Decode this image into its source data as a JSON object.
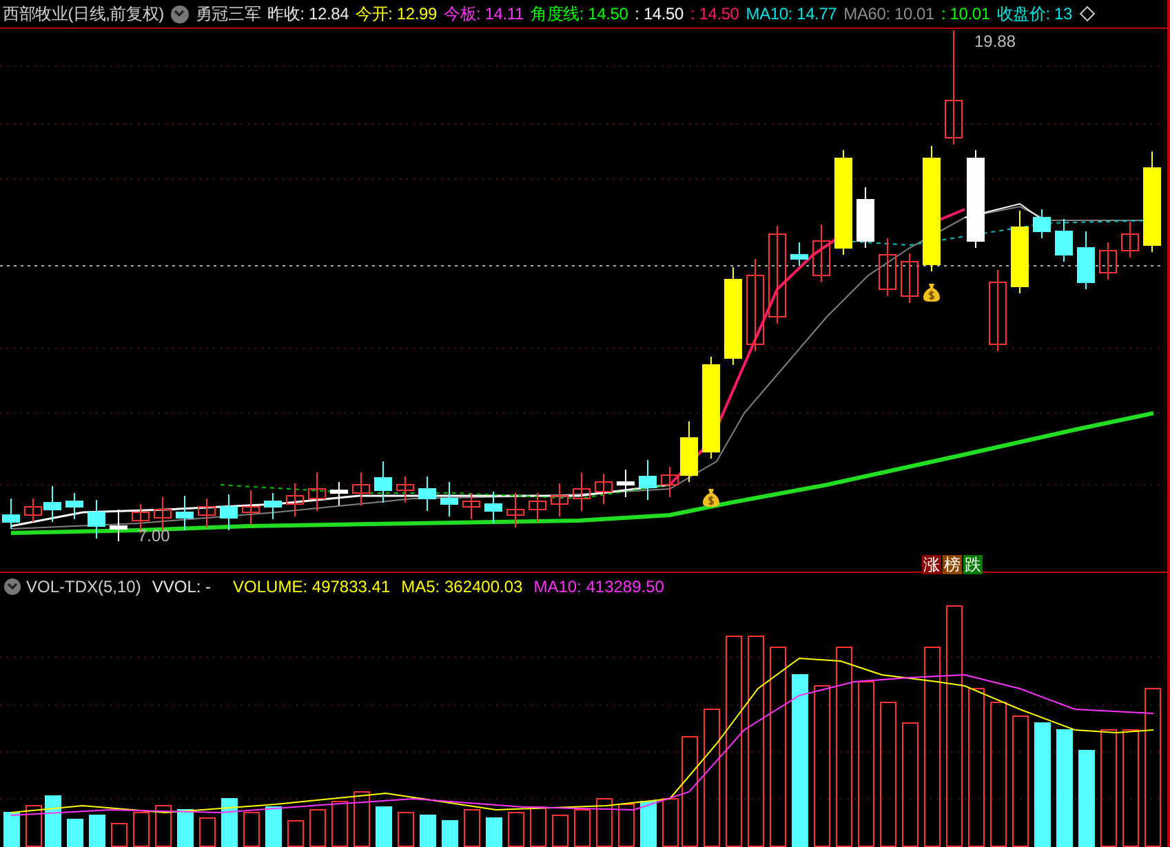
{
  "header": {
    "title": "西部牧业(日线,前复权)",
    "indicator_name": "勇冠三军",
    "values": [
      {
        "text": "昨收: 12.84",
        "color": "#e8e8e8"
      },
      {
        "text": "今开: 12.99",
        "color": "#ffff00"
      },
      {
        "text": "今板: 14.11",
        "color": "#ff33ff"
      },
      {
        "text": "角度线: 14.50",
        "color": "#00ff00"
      },
      {
        "text": ": 14.50",
        "color": "#ffffff"
      },
      {
        "text": ": 14.50",
        "color": "#ff1a66"
      },
      {
        "text": "MA10: 14.77",
        "color": "#00e5e5"
      },
      {
        "text": "MA60: 10.01",
        "color": "#8c8c8c"
      },
      {
        "text": ": 10.01",
        "color": "#00ff00"
      },
      {
        "text": "收盘价: 13",
        "color": "#00e5e5"
      }
    ]
  },
  "price_chart": {
    "high_label": "19.88",
    "low_label": "7.00",
    "badges": [
      {
        "text": "涨",
        "color": "#8b0000"
      },
      {
        "text": "榜",
        "color": "#8b4500"
      },
      {
        "text": "跌",
        "color": "#007a00"
      }
    ]
  },
  "volume_panel": {
    "name": "VOL-TDX(5,10)",
    "values": [
      {
        "text": "VVOL: -",
        "color": "#e8e8e8"
      },
      {
        "text": "VOLUME: 497833.41",
        "color": "#ffff00"
      },
      {
        "text": "MA5: 362400.03",
        "color": "#ffff00"
      },
      {
        "text": "MA10: 413289.50",
        "color": "#ff33ff"
      }
    ]
  }
}
